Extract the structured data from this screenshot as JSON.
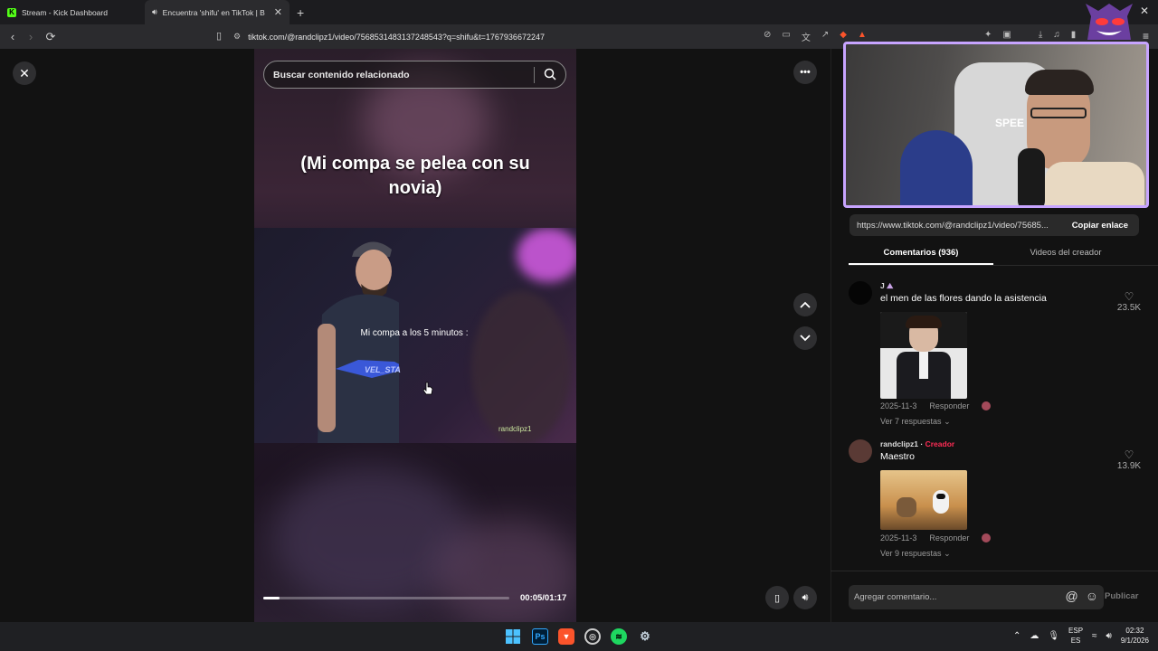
{
  "browser": {
    "tabs": [
      {
        "title": "Stream - Kick Dashboard",
        "favicon_color": "#53fc18"
      },
      {
        "title": "Encuentra 'shifu' en TikTok | B",
        "favicon_color": "#ffffff"
      }
    ],
    "new_tab": "+",
    "url": "tiktok.com/@randclipz1/video/7568531483137248543?q=shifu&t=1767936672247"
  },
  "video": {
    "search_placeholder": "Buscar contenido relacionado",
    "caption": "(Mi compa se pelea con su novia)",
    "clip_text": "Mi compa a los 5 minutos :",
    "watermark": "randclipz1",
    "shirt_text": "VEL_STA",
    "time": "00:05/01:17",
    "progress": 0.065
  },
  "panel": {
    "share_url": "https://www.tiktok.com/@randclipz1/video/75685...",
    "copy_label": "Copiar enlace",
    "tabs": [
      "Comentarios (936)",
      "Videos del creador"
    ],
    "comments": [
      {
        "user": "J",
        "badge": "",
        "text": "el men de las flores dando la asistencia",
        "date": "2025-11-3",
        "reply": "Responder",
        "more": "Ver 7 respuestas",
        "likes": "23.5K"
      },
      {
        "user": "randclipz1",
        "badge": "Creador",
        "text": "Maestro",
        "date": "2025-11-3",
        "reply": "Responder",
        "more": "Ver 9 respuestas",
        "likes": "13.9K"
      }
    ],
    "add_comment_placeholder": "Agregar comentario...",
    "publish_label": "Publicar"
  },
  "webcam": {
    "chair_text": "SPEE"
  },
  "taskbar": {
    "lang_top": "ESP",
    "lang_bottom": "ES",
    "time": "02:32",
    "date": "9/1/2026"
  },
  "colors": {
    "accent_creator": "#fe2c55",
    "cam_border": "#c7a4ff"
  }
}
